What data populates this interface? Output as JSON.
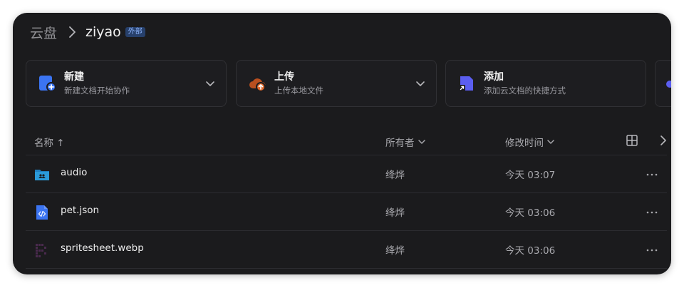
{
  "breadcrumb": {
    "root": "云盘",
    "current": "ziyao",
    "badge": "外部"
  },
  "cards": [
    {
      "title": "新建",
      "subtitle": "新建文档开始协作",
      "icon": "new-doc-icon",
      "color": "#3b74f2"
    },
    {
      "title": "上传",
      "subtitle": "上传本地文件",
      "icon": "upload-cloud-icon",
      "color": "#e0682b"
    },
    {
      "title": "添加",
      "subtitle": "添加云文档的快捷方式",
      "icon": "shortcut-icon",
      "color": "#5b5ef0"
    }
  ],
  "table": {
    "headers": {
      "name": "名称 ↑",
      "owner": "所有者",
      "modified": "修改时间"
    },
    "rows": [
      {
        "name": "audio",
        "owner": "绛烨",
        "modified": "今天 03:07",
        "icon": "folder-icon"
      },
      {
        "name": "pet.json",
        "owner": "绛烨",
        "modified": "今天 03:06",
        "icon": "code-file-icon"
      },
      {
        "name": "spritesheet.webp",
        "owner": "绛烨",
        "modified": "今天 03:06",
        "icon": "image-thumbnail-icon"
      }
    ]
  },
  "colors": {
    "background": "#1b1b1d",
    "accent": "#3b74f2",
    "badge": "#27406b"
  }
}
